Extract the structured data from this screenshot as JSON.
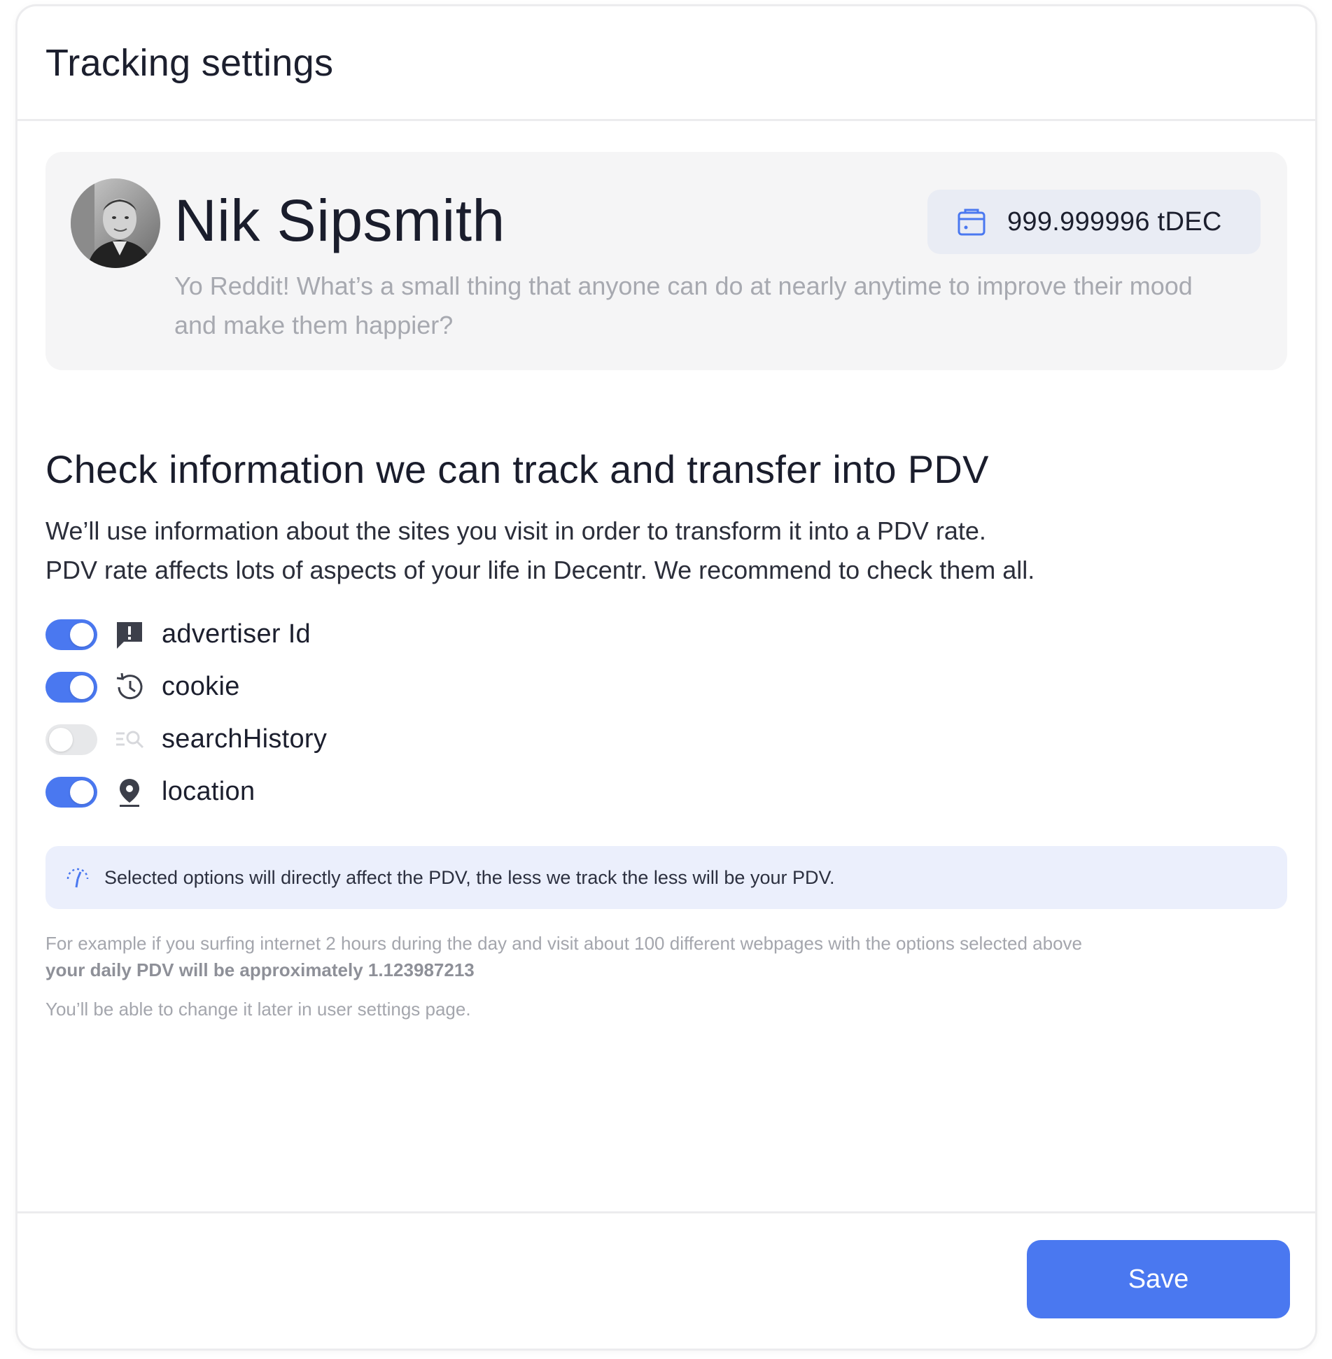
{
  "header": {
    "title": "Tracking settings"
  },
  "profile": {
    "avatar_icon": "user-photo-icon",
    "name": "Nik Sipsmith",
    "balance": "999.999996 tDEC",
    "balance_icon": "wallet-icon",
    "description": "Yo Reddit! What’s a small thing that anyone can do at nearly anytime to improve their mood and make them happier?"
  },
  "section": {
    "title": "Check information we can track and transfer into PDV",
    "description_line1": "We’ll use information about the sites you visit in order to transform it into a PDV rate.",
    "description_line2": "PDV rate affects lots of aspects of your life in Decentr. We recommend to check them all."
  },
  "options": [
    {
      "label": "advertiser Id",
      "enabled": true,
      "icon": "feedback-icon"
    },
    {
      "label": "cookie",
      "enabled": true,
      "icon": "history-icon"
    },
    {
      "label": "searchHistory",
      "enabled": false,
      "icon": "search-history-icon"
    },
    {
      "label": "location",
      "enabled": true,
      "icon": "location-pin-icon"
    }
  ],
  "notice": {
    "icon": "pdv-gauge-icon",
    "text": "Selected options will directly affect the PDV, the less we track the less will be your PDV."
  },
  "example": {
    "text": "For example if you surfing internet 2 hours during the day and visit about 100 different webpages with the options selected above",
    "bold": "your daily PDV will be approximately 1.123987213"
  },
  "later_note": "You’ll be able to change it later in user settings page.",
  "footer": {
    "save_label": "Save"
  },
  "colors": {
    "accent": "#4a78f0",
    "notice_bg": "#ebeffc",
    "profile_bg": "#f5f5f6"
  }
}
